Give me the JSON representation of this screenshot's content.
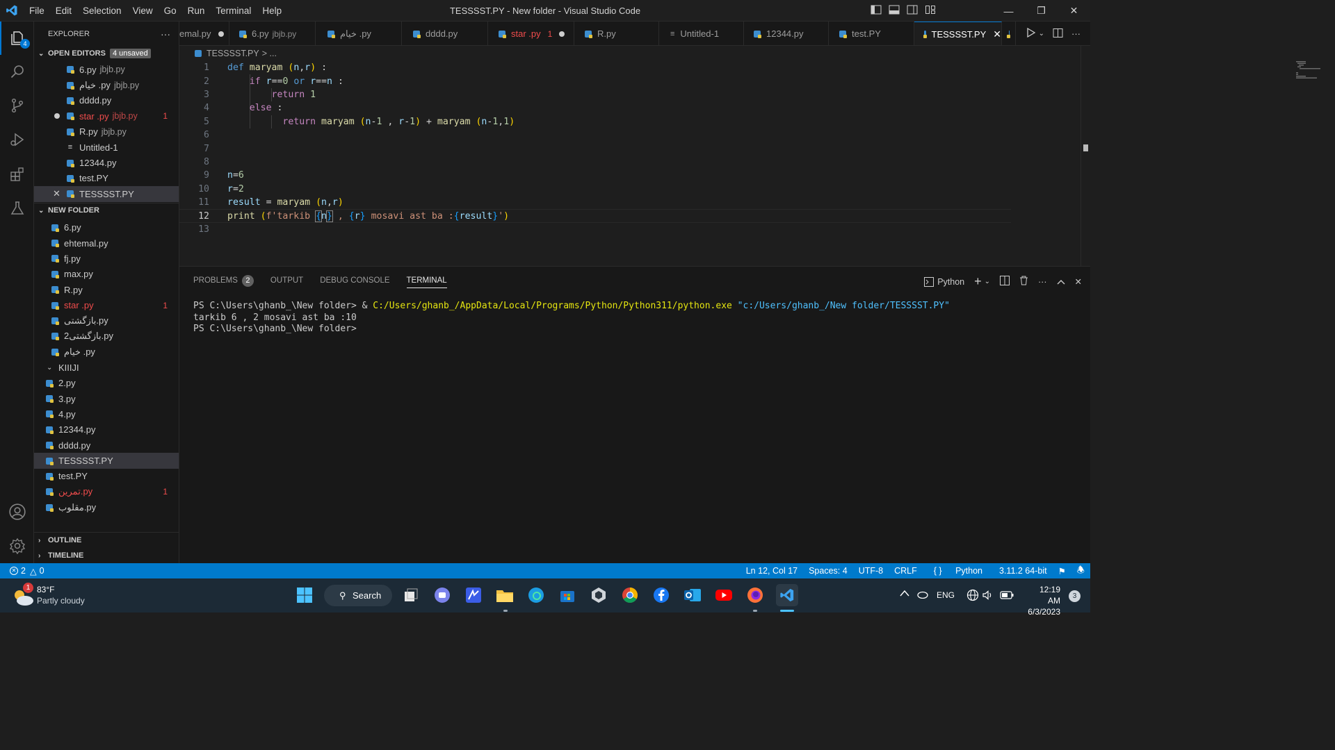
{
  "titlebar": {
    "menu": [
      "File",
      "Edit",
      "Selection",
      "View",
      "Go",
      "Run",
      "Terminal",
      "Help"
    ],
    "title": "TESSSST.PY - New folder - Visual Studio Code"
  },
  "activity": {
    "explorer_badge": "4"
  },
  "explorer": {
    "header": "EXPLORER",
    "more": "···",
    "open_editors": {
      "label": "OPEN EDITORS",
      "badge": "4 unsaved",
      "items": [
        {
          "name": "6.py",
          "desc": "jbjb.py"
        },
        {
          "name": "خیام .py",
          "desc": "jbjb.py"
        },
        {
          "name": "dddd.py",
          "desc": ""
        },
        {
          "name": "star .py",
          "desc": "jbjb.py",
          "errors": "1"
        },
        {
          "name": "R.py",
          "desc": "jbjb.py"
        },
        {
          "name": "Untitled-1",
          "desc": ""
        },
        {
          "name": "12344.py",
          "desc": ""
        },
        {
          "name": "test.PY",
          "desc": ""
        },
        {
          "name": "TESSSST.PY",
          "desc": ""
        }
      ]
    },
    "folder": {
      "label": "NEW FOLDER",
      "items": [
        "6.py",
        "ehtemal.py",
        "fj.py",
        "max.py",
        "R.py",
        "star .py",
        "بازگشتی.py",
        "بازگشتی2.py",
        "خیام .py"
      ],
      "star_errors": "1",
      "subfolder": "KIIIJI",
      "items2": [
        "2.py",
        "3.py",
        "4.py",
        "12344.py",
        "dddd.py",
        "TESSSST.PY",
        "test.PY",
        "تمرین.py",
        "مقلوب.py"
      ],
      "tamrin_errors": "1"
    },
    "outline": "OUTLINE",
    "timeline": "TIMELINE"
  },
  "tabs": [
    {
      "name": "emal.py"
    },
    {
      "name": "6.py",
      "desc": "jbjb.py"
    },
    {
      "name": "خیام .py"
    },
    {
      "name": "dddd.py"
    },
    {
      "name": "star .py",
      "errors": "1"
    },
    {
      "name": "R.py"
    },
    {
      "name": "Untitled-1"
    },
    {
      "name": "12344.py"
    },
    {
      "name": "test.PY"
    },
    {
      "name": "TESSSST.PY"
    }
  ],
  "breadcrumb": {
    "file": "TESSSST.PY",
    "rest": "> ..."
  },
  "editor": {
    "line_numbers": [
      "1",
      "2",
      "3",
      "4",
      "5",
      "6",
      "7",
      "8",
      "9",
      "10",
      "11",
      "12",
      "13"
    ]
  },
  "panel": {
    "tabs": [
      "PROBLEMS",
      "OUTPUT",
      "DEBUG CONSOLE",
      "TERMINAL"
    ],
    "problems_count": "2",
    "shell": "Python",
    "terminal": {
      "prompt1": "PS C:\\Users\\ghanb_\\New folder> & ",
      "exe": "C:/Users/ghanb_/AppData/Local/Programs/Python/Python311/python.exe",
      "arg": "\"c:/Users/ghanb_/New folder/TESSSST.PY\"",
      "output": "tarkib 6 , 2 mosavi ast ba :10",
      "prompt2": "PS C:\\Users\\ghanb_\\New folder>"
    }
  },
  "statusbar": {
    "errors": "2",
    "warnings": "0",
    "position": "Ln 12, Col 17",
    "spaces": "Spaces: 4",
    "encoding": "UTF-8",
    "eol": "CRLF",
    "language": "Python",
    "interpreter": "3.11.2 64-bit"
  },
  "taskbar": {
    "weather_badge": "1",
    "temperature": "83°F",
    "condition": "Partly cloudy",
    "search": "Search",
    "language": "ENG",
    "time": "12:19 AM",
    "date": "6/3/2023",
    "notifications": "3"
  },
  "colors": {
    "accent": "#007acc",
    "error": "#f14c4c",
    "python_icon": "#3c8dcf"
  }
}
